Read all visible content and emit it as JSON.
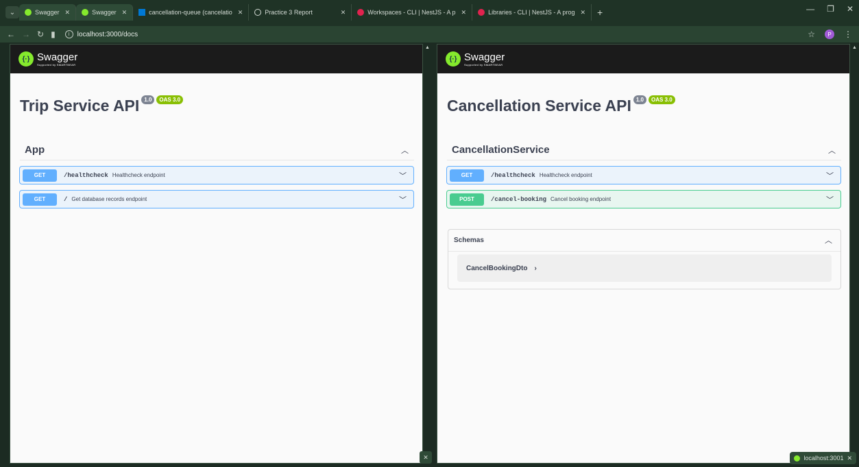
{
  "browser": {
    "tabs": [
      {
        "title": "Swagger",
        "favicon": "swagger-icon",
        "color": "#85ea2d"
      },
      {
        "title": "Swagger",
        "favicon": "swagger-icon",
        "color": "#85ea2d"
      },
      {
        "title": "cancellation-queue (cancelatio",
        "favicon": "azure-icon",
        "color": "#0078d4"
      },
      {
        "title": "Practice 3 Report",
        "favicon": "globe-icon",
        "color": "#d5dcd6"
      },
      {
        "title": "Workspaces - CLI | NestJS - A p",
        "favicon": "nestjs-icon",
        "color": "#e0234e"
      },
      {
        "title": "Libraries - CLI | NestJS - A prog",
        "favicon": "nestjs-icon",
        "color": "#e0234e"
      }
    ],
    "url": "localhost:3000/docs",
    "profile_initial": "P",
    "status_pill": "localhost:3001"
  },
  "left": {
    "brand": "Swagger",
    "brand_sub": "Supported by SMARTBEAR",
    "title": "Trip Service API",
    "version": "1.0",
    "oas": "OAS 3.0",
    "section": "App",
    "ops": [
      {
        "method": "GET",
        "path": "/healthcheck",
        "summary": "Healthcheck endpoint"
      },
      {
        "method": "GET",
        "path": "/",
        "summary": "Get database records endpoint"
      }
    ]
  },
  "right": {
    "brand": "Swagger",
    "brand_sub": "Supported by SMARTBEAR",
    "title": "Cancellation Service API",
    "version": "1.0",
    "oas": "OAS 3.0",
    "section": "CancellationService",
    "ops": [
      {
        "method": "GET",
        "path": "/healthcheck",
        "summary": "Healthcheck endpoint"
      },
      {
        "method": "POST",
        "path": "/cancel-booking",
        "summary": "Cancel booking endpoint"
      }
    ],
    "schemas_title": "Schemas",
    "schema_models": [
      "CancelBookingDto"
    ]
  }
}
